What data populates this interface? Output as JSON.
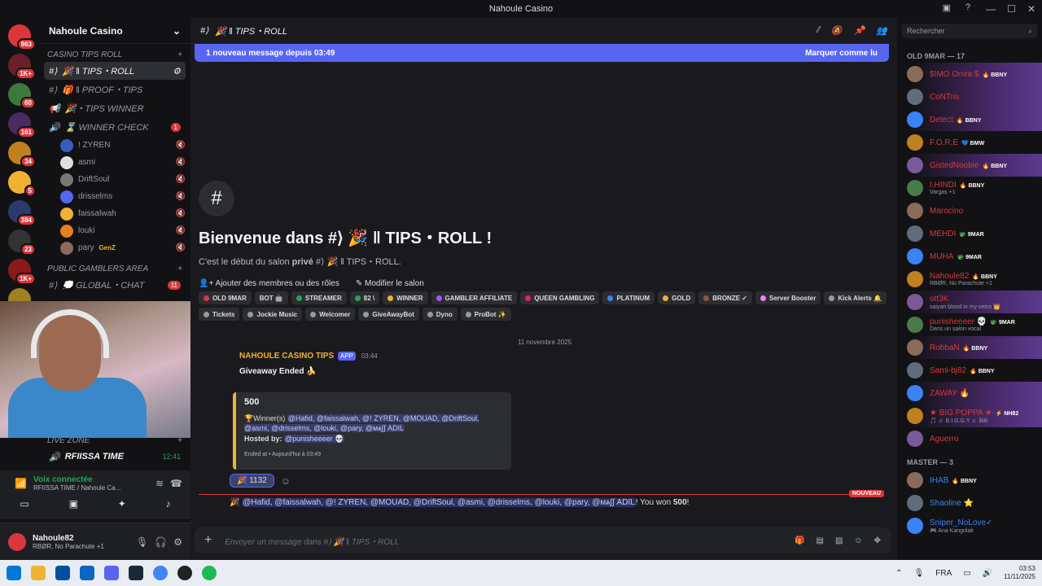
{
  "window": {
    "title": "Nahoule Casino"
  },
  "servers": {
    "badges": [
      "963",
      "1K+",
      "60",
      "161",
      "34",
      "5",
      "384",
      "23",
      "1K+",
      "4"
    ]
  },
  "guild": {
    "name": "Nahoule Casino"
  },
  "categories": {
    "tips": "CASINO TIPS ROLL",
    "public": "PUBLIC GAMBLERS AREA",
    "live": "LIVE ZONE"
  },
  "channels": [
    {
      "label": "🎉 ‖ TIPS・ROLL",
      "selected": true
    },
    {
      "label": "🎁 ‖ PROOF・TIPS"
    },
    {
      "label": "🎉・TIPS WINNER"
    },
    {
      "label": "⌛ WINNER CHECK",
      "count": "1"
    }
  ],
  "voice_users": [
    "! ZYREN",
    "asmi",
    "DriftSoul",
    "drisselms",
    "faissalwah",
    "louki",
    "pary"
  ],
  "voice_user_tag": "GenZ",
  "global_chat": {
    "label": "💭 GLOBAL・CHAT",
    "count": "11"
  },
  "live_channel": {
    "label": "RFIISSA TIME",
    "time": "12:41"
  },
  "voice_panel": {
    "status": "Voix connectée",
    "channel": "RFIISSA TIME / Nahoule Ca..."
  },
  "user_panel": {
    "name": "Nahoule82",
    "status": "RBØR, No Parachute +1"
  },
  "header": {
    "channel": "🎉 ‖ TIPS・ROLL"
  },
  "new_messages": {
    "text": "1 nouveau message depuis 03:49",
    "mark_read": "Marquer comme lu"
  },
  "welcome": {
    "title": "Bienvenue dans #⟩ 🎉 ‖ TIPS・ROLL !",
    "subtitle_pre": "C'est le début du salon ",
    "subtitle_bold": "privé",
    "subtitle_post": " #⟩ 🎉 ‖ TIPS・ROLL.",
    "add_members": "Ajouter des membres ou des rôles",
    "edit_channel": "Modifier le salon"
  },
  "roles": [
    {
      "label": "OLD 9MAR",
      "color": "#da373c"
    },
    {
      "label": "BOT 🤖",
      "color": ""
    },
    {
      "label": "STREAMER",
      "color": "#23a55a"
    },
    {
      "label": "82 \\",
      "color": "#23a55a"
    },
    {
      "label": "WINNER",
      "color": "#f0b232"
    },
    {
      "label": "GAMBLER AFFILIATE",
      "color": "#a855f7"
    },
    {
      "label": "QUEEN GAMBLING",
      "color": "#e91e63"
    },
    {
      "label": "PLATINUM",
      "color": "#3b82f6"
    },
    {
      "label": "GOLD",
      "color": "#f0b232"
    },
    {
      "label": "BRONZE ✓",
      "color": "#8b5a3c"
    },
    {
      "label": "Server Booster",
      "color": "#f47fff"
    },
    {
      "label": "Kick Alerts 🔔",
      "color": "#949ba4"
    },
    {
      "label": "Tickets",
      "color": "#949ba4"
    },
    {
      "label": "Jockie Music",
      "color": "#949ba4"
    },
    {
      "label": "Welcomer",
      "color": "#949ba4"
    },
    {
      "label": "GiveAwayBot",
      "color": "#949ba4"
    },
    {
      "label": "Dyno",
      "color": "#949ba4"
    },
    {
      "label": "ProBot ✨",
      "color": "#949ba4"
    }
  ],
  "date_divider": "11 novembre 2025",
  "message": {
    "author": "NAHOULE CASINO TIPS",
    "app": "APP",
    "time": "03:44",
    "title": "Giveaway Ended 🍌",
    "amount": "500",
    "winners_label": "Winner(s)",
    "winners": "@Hafid, @faissalwah, @! ZYREN, @MOUAD, @DriftSoul, @asmi, @drisselms, @louki, @pary, @ᴍѧ∫∫ ADIL",
    "hosted_label": "Hosted by:",
    "host": "@punisheeeer 💀",
    "ended": "Ended at • Aujourd'hui à 03:49",
    "reaction_count": "1132",
    "new_tag": "NOUVEAU",
    "win_mentions": "@Hafid, @faissalwah, @! ZYREN, @MOUAD, @DriftSoul, @asmi, @drisselms, @louki, @pary, @ᴍѧ∫∫ ADIL",
    "win_text": "! You won ",
    "win_amount": "500",
    "win_end": "!"
  },
  "input": {
    "placeholder": "Envoyer un message dans #⟩ 🎉 ‖ TIPS・ROLL"
  },
  "search": {
    "placeholder": "Rechercher"
  },
  "members": {
    "old_title": "OLD 9MAR — 17",
    "old": [
      {
        "name": "$IMO Omra $",
        "tag": "🔥 BBNY",
        "color": "#da373c",
        "banner": true
      },
      {
        "name": "CoNTris",
        "tag": "",
        "color": "#da373c",
        "banner": true
      },
      {
        "name": "Detect",
        "tag": "🔥 BBNY",
        "color": "#da373c",
        "banner": true
      },
      {
        "name": "F.O.R.E",
        "tag": "💙 BMW",
        "color": "#da373c"
      },
      {
        "name": "GistedNoobie",
        "tag": "🔥 BBNY",
        "color": "#da373c",
        "banner": true
      },
      {
        "name": "I.HINDI",
        "tag": "🔥 BBNY",
        "color": "#da373c",
        "status": "Vargas +1"
      },
      {
        "name": "Marocino",
        "tag": "",
        "color": "#da373c"
      },
      {
        "name": "MEHDI",
        "tag": "🐲 9MAR",
        "color": "#da373c"
      },
      {
        "name": "MUHA",
        "tag": "🐲 9MAR",
        "color": "#da373c"
      },
      {
        "name": "Nahoule82",
        "tag": "🔥 BBNY",
        "color": "#da373c",
        "status": "RBØR, No Parachute +1"
      },
      {
        "name": "ott3K",
        "tag": "",
        "color": "#da373c",
        "status": "saiyan blood in my veins 👑",
        "banner": true
      },
      {
        "name": "punisheeeer 💀",
        "tag": "🐲 9MAR",
        "color": "#da373c",
        "status": "Dans un salon vocal"
      },
      {
        "name": "RobbaN",
        "tag": "🔥 BBNY",
        "color": "#da373c",
        "banner": true
      },
      {
        "name": "Sami-bj82",
        "tag": "🔥 BBNY",
        "color": "#da373c"
      },
      {
        "name": "ZAWAY 🔥",
        "tag": "",
        "color": "#da373c",
        "banner": true
      },
      {
        "name": "★ BIG POPPA ★",
        "tag": "⚡ NH82",
        "color": "#da373c",
        "status": "🎵 ♬ B.I.G.G.Y ♬ illilli",
        "banner": true
      },
      {
        "name": "Aguerro",
        "tag": "",
        "color": "#da373c"
      }
    ],
    "master_title": "MASTER — 3",
    "master": [
      {
        "name": "IHAB",
        "tag": "🔥 BBNY",
        "color": "#3b82f6"
      },
      {
        "name": "Shaoline ⭐",
        "tag": "",
        "color": "#3b82f6"
      },
      {
        "name": "Sniper_NoLove✓",
        "tag": "",
        "color": "#3b82f6",
        "status": "🎮 Ana Kangolak"
      }
    ]
  },
  "taskbar": {
    "lang": "FRA",
    "time": "03:53",
    "date": "11/11/2025"
  }
}
